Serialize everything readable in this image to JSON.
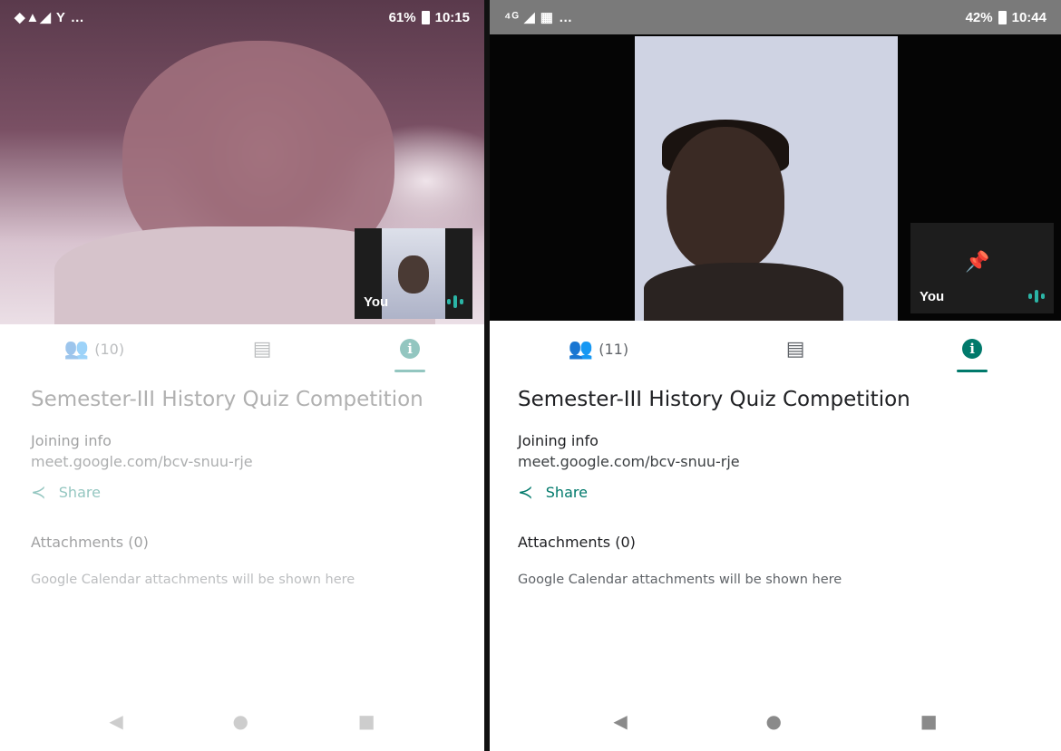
{
  "phones": {
    "left": {
      "status": {
        "left_icons": "◆▲◢ Y …",
        "battery": "61%",
        "time": "10:15"
      },
      "self_view_label": "You",
      "tabs": {
        "participants_count": "(10)"
      },
      "panel": {
        "title": "Semester-III History Quiz Competition",
        "joining_label": "Joining info",
        "link": "meet.google.com/bcv-snuu-rje",
        "share_label": "Share",
        "attachments_label": "Attachments (0)",
        "attachments_note": "Google Calendar attachments will be shown here"
      }
    },
    "right": {
      "status": {
        "left_icons": "⁴ᴳ ◢ ▦ …",
        "battery": "42%",
        "time": "10:44"
      },
      "self_view_label": "You",
      "tabs": {
        "participants_count": "(11)"
      },
      "panel": {
        "title": "Semester-III History Quiz Competition",
        "joining_label": "Joining info",
        "link": "meet.google.com/bcv-snuu-rje",
        "share_label": "Share",
        "attachments_label": "Attachments (0)",
        "attachments_note": "Google Calendar attachments will be shown here"
      }
    }
  },
  "icons": {
    "people": "people-icon",
    "chat": "chat-icon",
    "info": "info-icon",
    "share": "share-icon",
    "pin": "pin-icon",
    "audio": "audio-level-icon",
    "back": "back-icon",
    "home": "home-icon",
    "recents": "recents-icon"
  },
  "colors": {
    "accent": "#00796b",
    "audio": "#2bb5a6"
  }
}
